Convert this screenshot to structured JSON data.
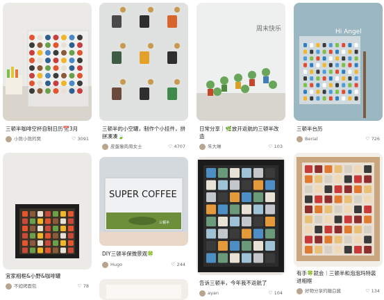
{
  "feed": [
    {
      "title": "三顿半咖啡空杯自制日历📆3月",
      "author": "小熊小熊的窝",
      "likes": "3091",
      "icon": "heart-icon"
    },
    {
      "title": "三顿半的小空罐，制作个小挂件，拼拼凑凑🍃",
      "author": "皮蛋瘦肉周女士",
      "likes": "4707",
      "icon": "heart-icon"
    },
    {
      "title": "日常分享｜🌿放开返航的三顿半改造",
      "author": "朱大琳",
      "likes": "103",
      "icon": "heart-icon"
    },
    {
      "title": "三顿半台历",
      "author": "Berial",
      "likes": "726",
      "icon": "heart-icon"
    },
    {
      "title": "宜家相框&小野&咖啡罐",
      "author": "不如烤面包",
      "likes": "78",
      "icon": "heart-icon"
    },
    {
      "title": "DIY三顿半保微景观🍀",
      "author": "Hugo",
      "likes": "244",
      "icon": "heart-icon"
    },
    {
      "title": "告诉三顿半，今年我不返航了",
      "author": "ayan",
      "likes": "104",
      "icon": "heart-icon"
    },
    {
      "title": "有手🍀就会｜三顿半和泡泡玛特装进相框",
      "author": "好物分享的糖白酱",
      "likes": "134",
      "icon": "heart-icon"
    }
  ],
  "image_text": {
    "super_coffee": "SUPER COFFEE",
    "sandun": "三顿半",
    "zhou": "周末快乐",
    "hi": "Hi Angel"
  }
}
